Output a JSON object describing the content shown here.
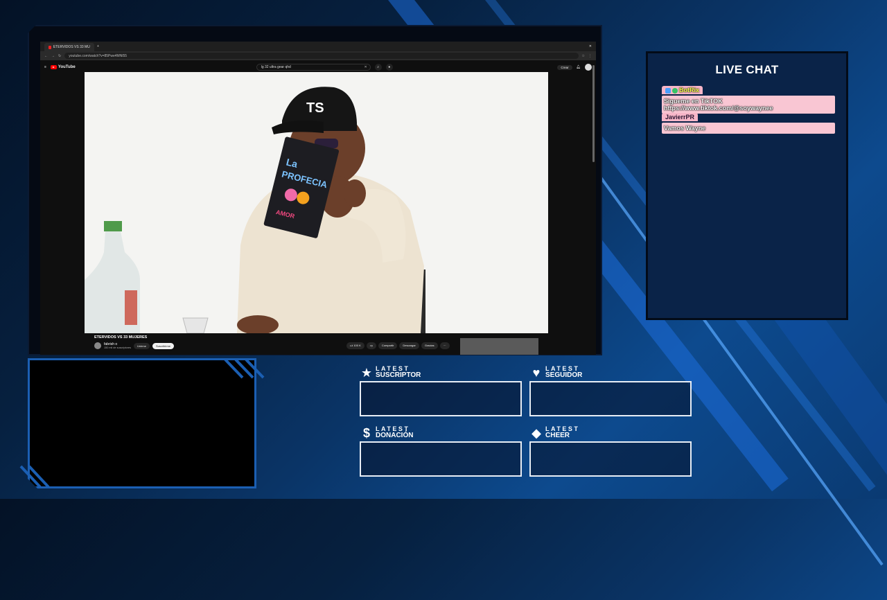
{
  "browser": {
    "tab_title": "ETERVIDOS VS 33 MUJERES",
    "url": "youtube.com/watch?v=85Pwe4MNl55",
    "yt_logo_text": "YouTube",
    "search_query": "lg 32 ultra gear qhd",
    "create_label": "Crear"
  },
  "video": {
    "title": "ETERVIDOS VS 33 MUJERES",
    "channel": "fabrish o",
    "subscribers": "150 mil de suscriptores",
    "join_label": "Unirme",
    "subscribe_label": "Suscribirme",
    "likes": "100 K",
    "share_label": "Compartir",
    "download_label": "Descargar",
    "thanks_label": "Gracias",
    "more_label": "···"
  },
  "chat": {
    "title": "LIVE CHAT",
    "messages": [
      {
        "user": "BotRix",
        "text": "Sigueme en TikTOK https://www.tiktok.com/@soywaynee"
      },
      {
        "user": "JavierrPR",
        "text": "Vamos Wayne"
      }
    ]
  },
  "latest": {
    "suscriptor": {
      "small": "LATEST",
      "big": "SUSCRIPTOR",
      "icon": "star-icon"
    },
    "seguidor": {
      "small": "LATEST",
      "big": "SEGUIDOR",
      "icon": "heart-icon"
    },
    "donacion": {
      "small": "LATEST",
      "big": "DONACIÓN",
      "icon": "dollar-icon"
    },
    "cheer": {
      "small": "LATEST",
      "big": "CHEER",
      "icon": "diamond-icon"
    }
  },
  "colors": {
    "accent": "#1b5fb3",
    "background": "#06203f",
    "chat_bubble": "#f9c6d3"
  }
}
